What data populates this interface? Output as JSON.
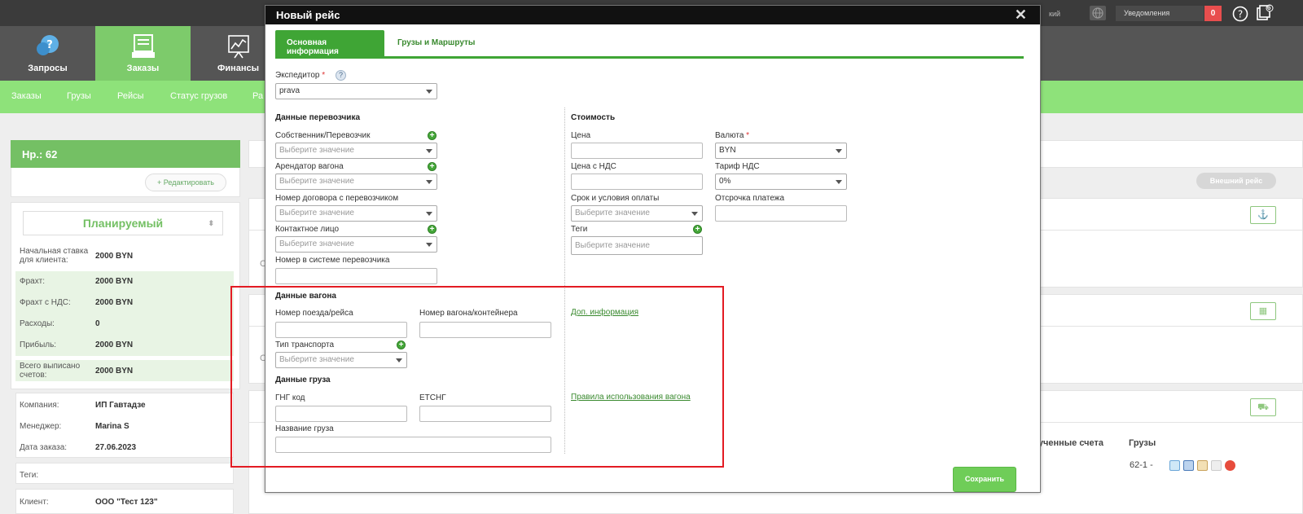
{
  "nav": {
    "items": [
      {
        "label": "Запросы",
        "icon": "question-bubble-icon",
        "active": false
      },
      {
        "label": "Заказы",
        "icon": "clipboard-icon",
        "active": true
      },
      {
        "label": "Финансы",
        "icon": "chart-board-icon",
        "active": false
      }
    ]
  },
  "subnav": {
    "items": [
      "Заказы",
      "Грузы",
      "Рейсы",
      "Статус грузов",
      "Ра"
    ]
  },
  "topbar": {
    "partial_text": "кий",
    "notifications_label": "Уведомления",
    "notifications_count": "0",
    "help_icon": "?",
    "docs_count": "6"
  },
  "side": {
    "header": "Нр.: 62",
    "edit_label": "+ Редактировать",
    "status": "Планируемый",
    "rows": [
      {
        "k": "Начальная ставка для клиента:",
        "v": "2000 BYN"
      },
      {
        "k": "Фрахт:",
        "v": "2000 BYN"
      },
      {
        "k": "Фрахт с НДС:",
        "v": "2000 BYN"
      },
      {
        "k": "Расходы:",
        "v": "0"
      },
      {
        "k": "Прибыль:",
        "v": "2000 BYN"
      },
      {
        "k": "Всего выписано счетов:",
        "v": "2000 BYN"
      }
    ],
    "company_label": "Компания:",
    "company": "ИП Гавтадзе",
    "manager_label": "Менеджер:",
    "manager": "Marina S",
    "date_label": "Дата заказа:",
    "date": "27.06.2023",
    "tags_label": "Теги:",
    "client_label": "Клиент:",
    "client": "ООО \"Тест 123\""
  },
  "background": {
    "external_flight": "Внешний рейс",
    "col_invoices": "лученные счета",
    "col_cargo": "Грузы",
    "cargo_value": "62-1 -",
    "side_c1": "С",
    "side_c2": "С"
  },
  "modal": {
    "title": "Новый рейс",
    "tabs": [
      "Основная информация",
      "Грузы и Маршруты"
    ],
    "expeditor_label": "Экспедитор",
    "expeditor_value": "prava",
    "carrier_section": "Данные перевозчика",
    "owner_label": "Собственник/Перевозчик",
    "lessee_label": "Арендатор вагона",
    "contract_label": "Номер договора с перевозчиком",
    "contact_label": "Контактное лицо",
    "carrier_system_label": "Номер в системе перевозчика",
    "placeholder": "Выберите значение",
    "cost_section": "Стоимость",
    "price_label": "Цена",
    "currency_label": "Валюта",
    "currency_value": "BYN",
    "price_vat_label": "Цена с НДС",
    "vat_rate_label": "Тариф НДС",
    "vat_rate_value": "0%",
    "payment_terms_label": "Срок и условия оплаты",
    "payment_delay_label": "Отсрочка платежа",
    "tags_label": "Теги",
    "wagon_section": "Данные вагона",
    "train_label": "Номер поезда/рейса",
    "wagon_label": "Номер вагона/контейнера",
    "transport_type_label": "Тип транспорта",
    "extra_info_link": "Доп. информация",
    "cargo_section": "Данные груза",
    "gng_label": "ГНГ код",
    "etsng_label": "ЕТСНГ",
    "cargo_name_label": "Название груза",
    "wagon_rules_link": "Правила использования вагона",
    "save_label": "Сохранить"
  },
  "colors": {
    "accent": "#3fa535",
    "nav_active": "#7dcb6b",
    "subnav": "#8ee27a",
    "highlight": "#e31b23"
  }
}
